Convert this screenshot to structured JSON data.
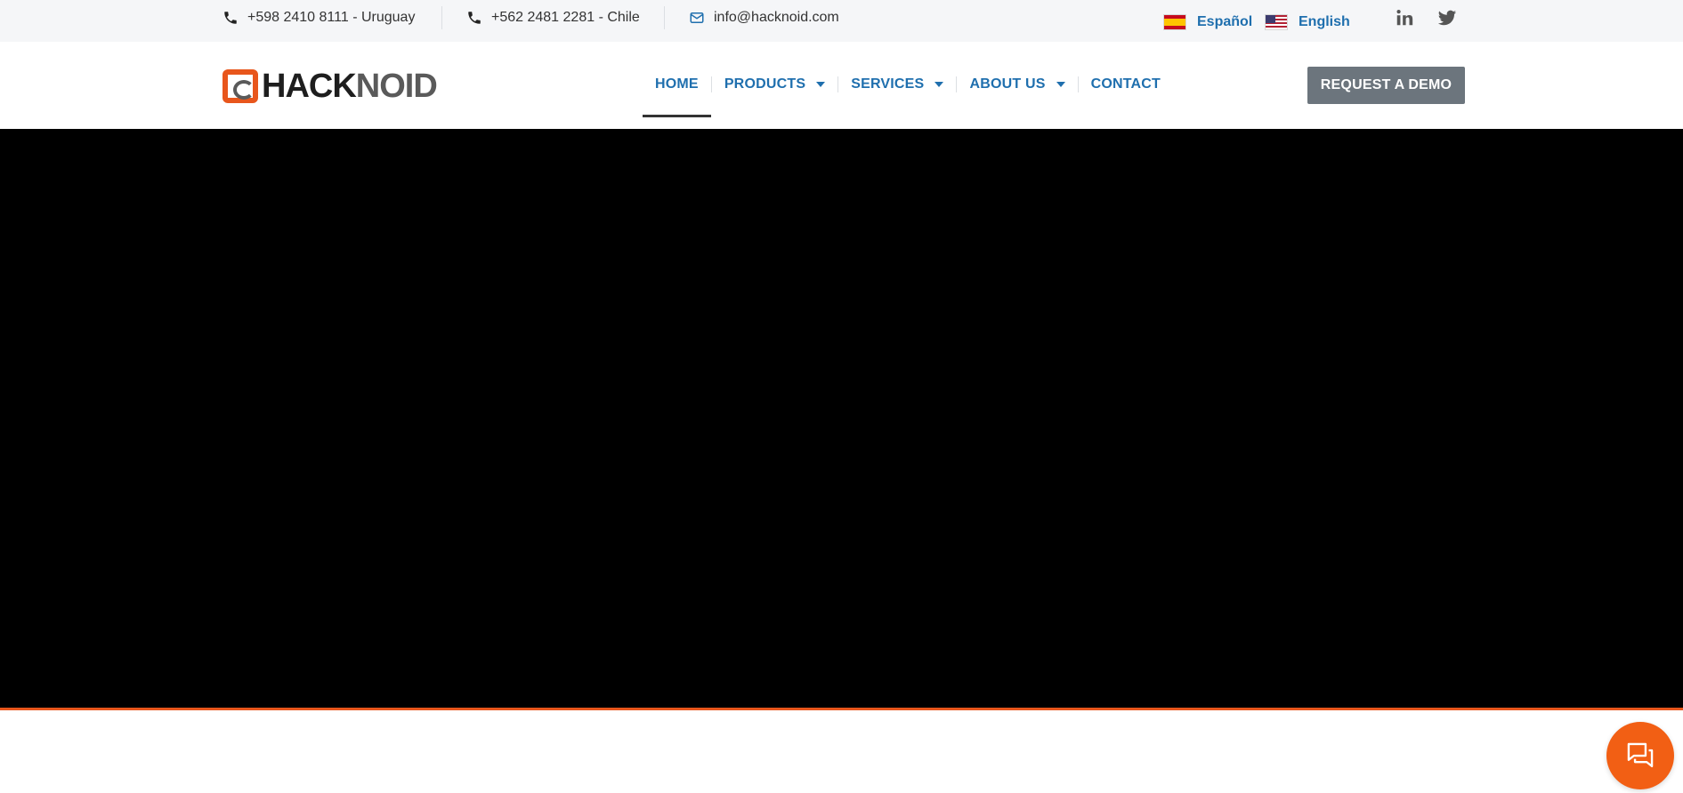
{
  "topbar": {
    "phone_uy": "+598 2410 8111 - Uruguay",
    "phone_cl": "+562 2481 2281 - Chile",
    "email": "info@hacknoid.com",
    "lang_es": "Español",
    "lang_en": "English",
    "icons": [
      "phone-icon",
      "phone-icon",
      "mail-icon",
      "spain-flag-icon",
      "us-flag-icon",
      "linkedin-icon",
      "twitter-icon"
    ]
  },
  "header": {
    "logo_text_a": "HACK",
    "logo_text_b": "NOID",
    "nav": {
      "home": "HOME",
      "products": "PRODUCTS",
      "services": "SERVICES",
      "about": "ABOUT US",
      "contact": "CONTACT"
    },
    "demo_label": "REQUEST A DEMO"
  },
  "colors": {
    "accent": "#e8561c",
    "nav_link": "#1f6fae",
    "button_bg": "#6c757d",
    "chat_bg": "#f25f14",
    "hero_bg": "#000000"
  }
}
